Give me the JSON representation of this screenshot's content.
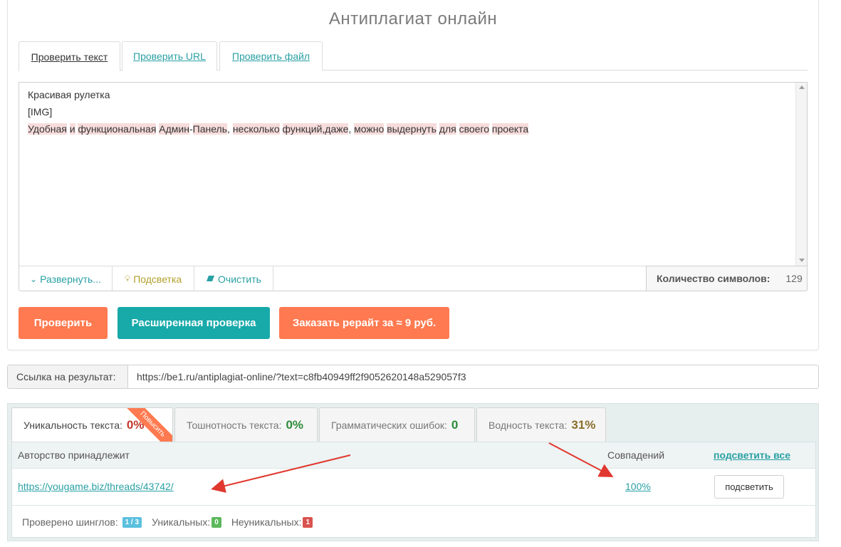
{
  "page": {
    "title": "Антиплагиат онлайн"
  },
  "tabs": [
    {
      "label": "Проверить текст",
      "active": true
    },
    {
      "label": "Проверить URL",
      "active": false
    },
    {
      "label": "Проверить файл",
      "active": false
    }
  ],
  "editor": {
    "lines": [
      "Красивая рулетка",
      "[IMG]"
    ],
    "highlighted_line": [
      "Удобная",
      "и",
      "функциональная",
      "Админ",
      "Панель",
      "несколько",
      "функций,даже",
      "можно",
      "выдернуть",
      "для",
      "своего",
      "проекта"
    ]
  },
  "toolbar": {
    "expand_label": "Развернуть...",
    "highlight_label": "Подсветка",
    "clear_label": "Очистить",
    "char_count_label": "Количество символов:",
    "char_count_value": "129"
  },
  "actions": {
    "check_label": "Проверить",
    "extended_label": "Расширенная проверка",
    "rewrite_label": "Заказать рерайт за ≈ 9 руб."
  },
  "result": {
    "label": "Ссылка на результат:",
    "url": "https://be1.ru/antiplagiat-online/?text=c8fb40949ff2f9052620148a529057f3"
  },
  "stats": {
    "uniqueness_label": "Уникальность текста:",
    "uniqueness_value": "0%",
    "ribbon": "Повысить",
    "nausea_label": "Тошнотность текста:",
    "nausea_value": "0%",
    "grammar_label": "Грамматических ошибок:",
    "grammar_value": "0",
    "water_label": "Водность текста:",
    "water_value": "31%"
  },
  "table": {
    "col_author": "Авторство принадлежит",
    "col_matches": "Совпадений",
    "highlight_all": "подсветить все",
    "rows": [
      {
        "url": "https://yougame.biz/threads/43742/",
        "percent": "100%",
        "button": "подсветить"
      }
    ],
    "footer": {
      "shingles_label": "Проверено шинглов:",
      "shingles_value": "1 / 3",
      "unique_label": "Уникальных:",
      "unique_value": "0",
      "nonunique_label": "Неуникальных:",
      "nonunique_value": "1"
    }
  },
  "colors": {
    "accent_teal": "#18a9a9",
    "accent_orange": "#ff7a50",
    "link": "#2aa0a4",
    "highlight_bg": "#f7dcdc",
    "arrow": "#e0382e"
  }
}
